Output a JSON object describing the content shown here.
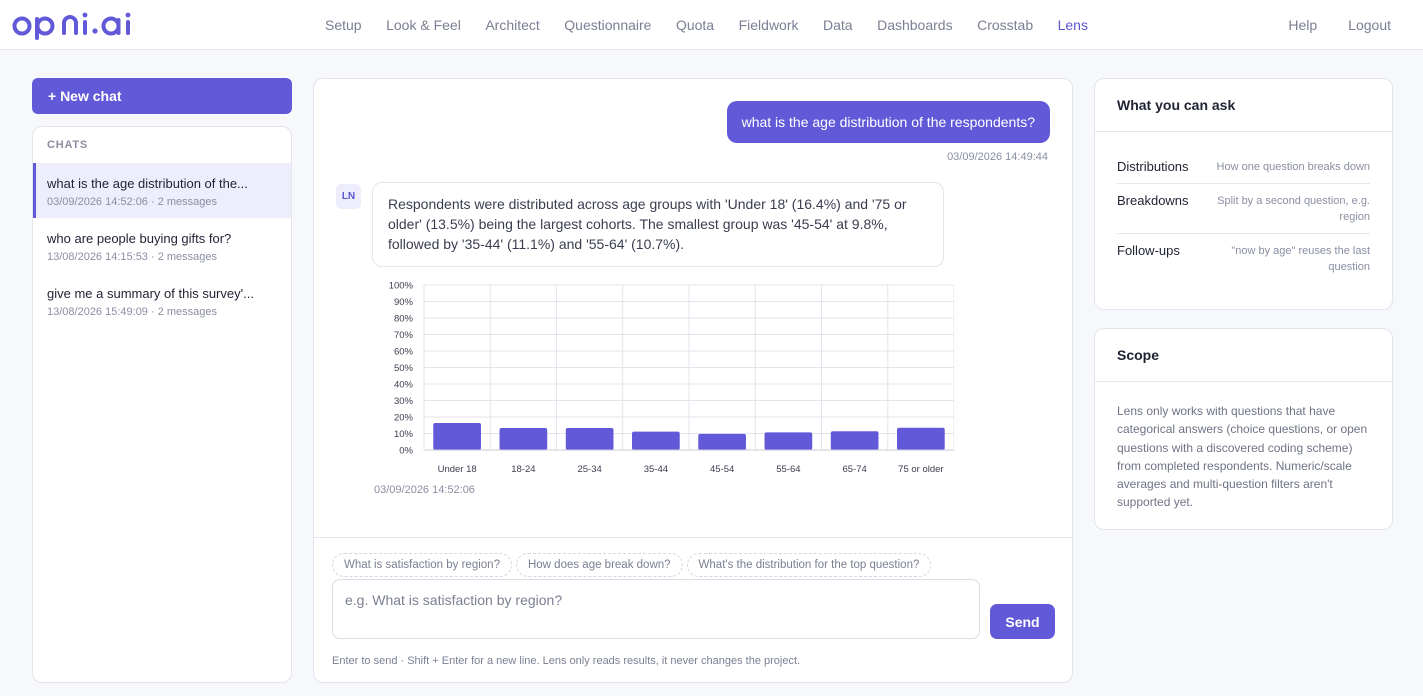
{
  "brand": {
    "logo_text": "opini.ai",
    "accent": "#6259d8"
  },
  "nav": {
    "items": [
      "Setup",
      "Look & Feel",
      "Architect",
      "Questionnaire",
      "Quota",
      "Fieldwork",
      "Data",
      "Dashboards",
      "Crosstab",
      "Lens"
    ],
    "active": "Lens",
    "right": [
      "Help",
      "Logout"
    ]
  },
  "sidebar": {
    "new_chat_label": "+ New chat",
    "chats_heading": "CHATS",
    "chats": [
      {
        "title": "what is the age distribution of the...",
        "meta": "03/09/2026 14:52:06 · 2 messages",
        "active": true
      },
      {
        "title": "who are people buying gifts for?",
        "meta": "13/08/2026 14:15:53 · 2 messages",
        "active": false
      },
      {
        "title": "give me a summary of this survey'...",
        "meta": "13/08/2026 15:49:09 · 2 messages",
        "active": false
      }
    ]
  },
  "conversation": {
    "user_message": "what is the age distribution of the respondents?",
    "user_time": "03/09/2026 14:49:44",
    "bot_avatar": "LN",
    "bot_message": "Respondents were distributed across age groups with 'Under 18' (16.4%) and '75 or older' (13.5%) being the largest cohorts. The smallest group was '45-54' at 9.8%, followed by '35-44' (11.1%) and '55-64' (10.7%).",
    "bot_time": "03/09/2026 14:52:06"
  },
  "chart_data": {
    "type": "bar",
    "categories": [
      "Under 18",
      "18-24",
      "25-34",
      "35-44",
      "45-54",
      "55-64",
      "65-74",
      "75 or older"
    ],
    "values": [
      16.4,
      13.3,
      13.3,
      11.1,
      9.8,
      10.7,
      11.4,
      13.5
    ],
    "yticks": [
      "0%",
      "10%",
      "20%",
      "30%",
      "40%",
      "50%",
      "60%",
      "70%",
      "80%",
      "90%",
      "100%"
    ],
    "ylim": [
      0,
      100
    ],
    "grid": true,
    "bar_color": "#6259d8"
  },
  "composer": {
    "suggestions": [
      "What is satisfaction by region?",
      "How does age break down?",
      "What's the distribution for the top question?"
    ],
    "placeholder": "e.g. What is satisfaction by region?",
    "send_label": "Send",
    "hint": "Enter to send · Shift + Enter for a new line. Lens only reads results, it never changes the project."
  },
  "ask_panel": {
    "title": "What you can ask",
    "rows": [
      {
        "key": "Distributions",
        "value": "How one question breaks down"
      },
      {
        "key": "Breakdowns",
        "value": "Split by a second question, e.g. region"
      },
      {
        "key": "Follow-ups",
        "value": "\"now by age\" reuses the last question"
      }
    ]
  },
  "scope_panel": {
    "title": "Scope",
    "text": "Lens only works with questions that have categorical answers (choice questions, or open questions with a discovered coding scheme) from completed respondents. Numeric/scale averages and multi-question filters aren't supported yet."
  }
}
